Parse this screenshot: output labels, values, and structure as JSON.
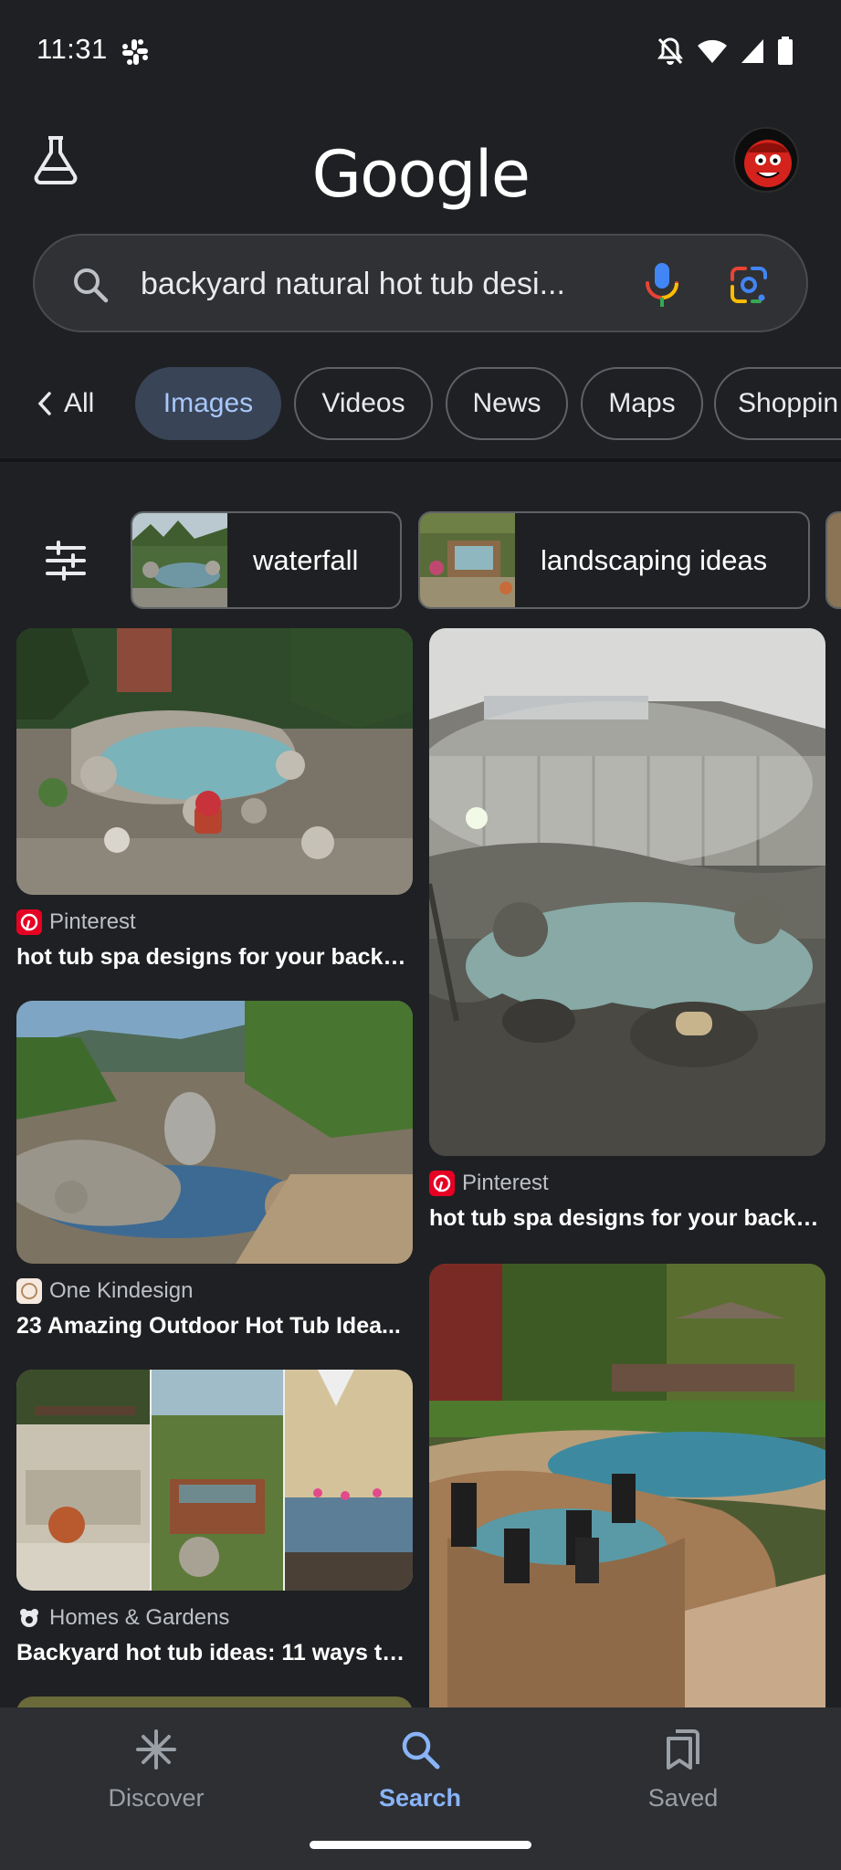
{
  "status_bar": {
    "time": "11:31",
    "icons": [
      "slack-icon",
      "do-not-disturb-icon",
      "wifi-icon",
      "cellular-signal-icon",
      "battery-icon"
    ]
  },
  "header": {
    "logo_text": "Google",
    "left_icon": "labs-flask-icon",
    "avatar": "account-avatar"
  },
  "search": {
    "query": "backyard natural hot tub desi...",
    "icons": [
      "search-icon",
      "mic-icon",
      "lens-icon"
    ]
  },
  "tabs": {
    "back_label": "All",
    "items": [
      {
        "label": "Images",
        "active": true
      },
      {
        "label": "Videos",
        "active": false
      },
      {
        "label": "News",
        "active": false
      },
      {
        "label": "Maps",
        "active": false
      },
      {
        "label": "Shoppin",
        "active": false
      }
    ]
  },
  "chips": [
    {
      "label": "waterfall"
    },
    {
      "label": "landscaping ideas"
    }
  ],
  "results": {
    "left": [
      {
        "source": "Pinterest",
        "title": "hot tub spa designs for your backy..."
      },
      {
        "source": "One Kindesign",
        "title": "23 Amazing Outdoor Hot Tub Idea..."
      },
      {
        "source": "Homes & Gardens",
        "title": "Backyard hot tub ideas: 11 ways to..."
      }
    ],
    "right": [
      {
        "source": "Pinterest",
        "title": "hot tub spa designs for your backy..."
      }
    ]
  },
  "bottom_nav": {
    "items": [
      {
        "label": "Discover",
        "icon": "discover-asterisk-icon",
        "active": false
      },
      {
        "label": "Search",
        "icon": "search-icon",
        "active": true
      },
      {
        "label": "Saved",
        "icon": "saved-bookmarks-icon",
        "active": false
      }
    ]
  },
  "colors": {
    "background": "#1f2023",
    "accent": "#8ab4f8",
    "active_tab_bg": "#394457",
    "pinterest": "#e60023"
  }
}
